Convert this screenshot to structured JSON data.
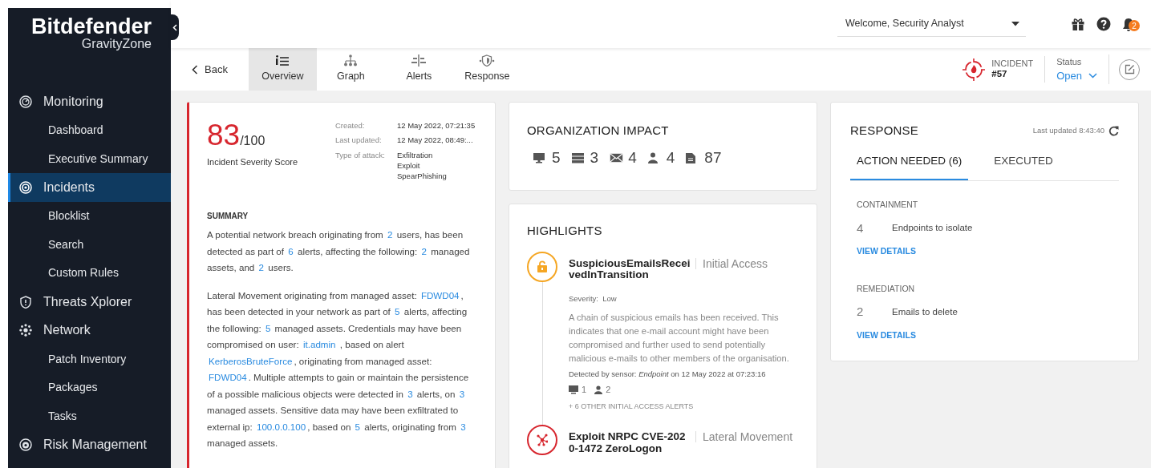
{
  "brand": {
    "name": "Bitdefender",
    "product": "GravityZone"
  },
  "sidebar": {
    "items": [
      {
        "label": "Monitoring",
        "kind": "gauge",
        "selected": false,
        "children": [
          {
            "label": "Dashboard",
            "selected": false
          },
          {
            "label": "Executive Summary",
            "selected": false
          }
        ]
      },
      {
        "label": "Incidents",
        "kind": "target",
        "selected": true,
        "children": [
          {
            "label": "Blocklist",
            "selected": false
          },
          {
            "label": "Search",
            "selected": false
          },
          {
            "label": "Custom Rules",
            "selected": false
          }
        ]
      },
      {
        "label": "Threats Xplorer",
        "kind": "shield",
        "selected": false
      },
      {
        "label": "Network",
        "kind": "network",
        "selected": false,
        "children": [
          {
            "label": "Patch Inventory",
            "selected": false
          },
          {
            "label": "Packages",
            "selected": false
          },
          {
            "label": "Tasks",
            "selected": false
          }
        ]
      },
      {
        "label": "Risk Management",
        "kind": "risk",
        "selected": false
      }
    ]
  },
  "header": {
    "user_menu": "Welcome, Security Analyst",
    "notifications": "2"
  },
  "toolbar": {
    "back": "Back",
    "tabs": [
      {
        "label": "Overview",
        "kind": "overview",
        "selected": true
      },
      {
        "label": "Graph",
        "kind": "graph",
        "selected": false
      },
      {
        "label": "Alerts",
        "kind": "alerts",
        "selected": false
      },
      {
        "label": "Response",
        "kind": "response",
        "selected": false
      }
    ],
    "incident": {
      "label": "INCIDENT",
      "number": "#57"
    },
    "status": {
      "label": "Status",
      "value": "Open"
    }
  },
  "overview": {
    "score": "83",
    "score_max": "/100",
    "score_label": "Incident Severity Score",
    "meta": [
      {
        "label": "Created:",
        "values": [
          "12 May 2022, 07:21:35"
        ]
      },
      {
        "label": "Last updated:",
        "values": [
          "12 May 2022, 08:49:..."
        ]
      },
      {
        "label": "Type of attack:",
        "values": [
          "Exfiltration",
          "Exploit",
          "SpearPhishing"
        ]
      }
    ],
    "summary_title": "SUMMARY",
    "paragraphs": [
      [
        {
          "text": "A potential network breach originating from ",
          "link": false
        },
        {
          "text": "2",
          "link": true
        },
        {
          "text": " users, has been detected as part of ",
          "link": false
        },
        {
          "text": "6",
          "link": true
        },
        {
          "text": " alerts, affecting the following: ",
          "link": false
        },
        {
          "text": "2",
          "link": true
        },
        {
          "text": " managed assets, and ",
          "link": false
        },
        {
          "text": "2",
          "link": true
        },
        {
          "text": " users.",
          "link": false
        }
      ],
      [
        {
          "text": "Lateral Movement originating from managed asset: ",
          "link": false
        },
        {
          "text": "FDWD04",
          "link": true
        },
        {
          "text": ", has been detected in your network as part of ",
          "link": false
        },
        {
          "text": "5",
          "link": true
        },
        {
          "text": " alerts, affecting the following: ",
          "link": false
        },
        {
          "text": "5",
          "link": true
        },
        {
          "text": " managed assets. Credentials may have been compromised on user: ",
          "link": false
        },
        {
          "text": "it.admin",
          "link": true
        },
        {
          "text": " , based on alert ",
          "link": false
        },
        {
          "text": "KerberosBruteForce",
          "link": true
        },
        {
          "text": ", originating from managed asset: ",
          "link": false
        },
        {
          "text": "FDWD04",
          "link": true
        },
        {
          "text": ". Multiple attempts to gain or maintain the persistence of a possible malicious objects were detected in ",
          "link": false
        },
        {
          "text": "3",
          "link": true
        },
        {
          "text": " alerts, on ",
          "link": false
        },
        {
          "text": "3",
          "link": true
        },
        {
          "text": " managed assets. Sensitive data may have been exfiltrated to external ip: ",
          "link": false
        },
        {
          "text": "100.0.0.100",
          "link": true
        },
        {
          "text": ", based on ",
          "link": false
        },
        {
          "text": "5",
          "link": true
        },
        {
          "text": " alerts, originating from ",
          "link": false
        },
        {
          "text": "3",
          "link": true
        },
        {
          "text": " managed assets.",
          "link": false
        }
      ]
    ]
  },
  "impact": {
    "title": "ORGANIZATION IMPACT",
    "items": [
      {
        "kind": "endpoint",
        "value": "5"
      },
      {
        "kind": "server",
        "value": "3"
      },
      {
        "kind": "email",
        "value": "4"
      },
      {
        "kind": "user",
        "value": "4"
      },
      {
        "kind": "file",
        "value": "87"
      }
    ]
  },
  "highlights": {
    "title": "HIGHLIGHTS",
    "items": [
      {
        "kind": "lock",
        "color": "#f5a623",
        "title": "SuspiciousEmailsReceivedInTransition",
        "tactic": "Initial Access",
        "severity_label": "Severity:",
        "severity": "Low",
        "description": "A chain of suspicious emails has been received. This indicates that one e-mail account might have been compromised and further used to send potentially malicious e-mails to other members of the organisation.",
        "detected": "Detected by sensor: *Endpoint* on 12 May 2022 at 07:23:16",
        "endpoints": "1",
        "users": "2",
        "more": "+ 6 OTHER INITIAL ACCESS ALERTS"
      },
      {
        "kind": "network",
        "color": "#d7262e",
        "title": "Exploit NRPC CVE-2020-1472 ZeroLogon",
        "tactic": "Lateral Movement"
      }
    ]
  },
  "response": {
    "title": "RESPONSE",
    "last_updated": "Last updated 8:43:40",
    "tabs": [
      {
        "label": "ACTION NEEDED (6)",
        "selected": true
      },
      {
        "label": "EXECUTED",
        "selected": false
      }
    ],
    "sections": [
      {
        "title": "CONTAINMENT",
        "count": "4",
        "text": "Endpoints to isolate",
        "link": "VIEW DETAILS"
      },
      {
        "title": "REMEDIATION",
        "count": "2",
        "text": "Emails to delete",
        "link": "VIEW DETAILS"
      }
    ]
  }
}
